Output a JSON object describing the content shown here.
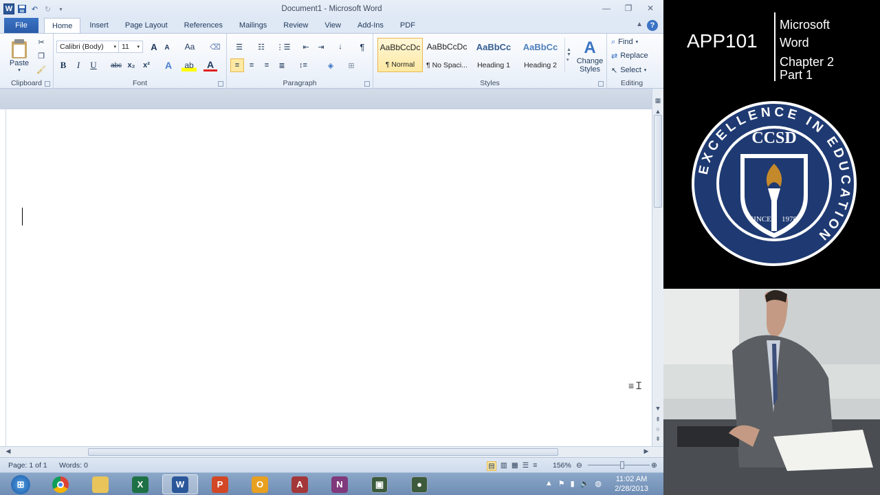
{
  "window": {
    "title": "Document1 - Microsoft Word",
    "logo": "W"
  },
  "qat": {
    "icons": [
      "word-app-icon",
      "save-icon",
      "undo-icon",
      "redo-icon",
      "customize-qat-icon"
    ]
  },
  "tabs": [
    "File",
    "Home",
    "Insert",
    "Page Layout",
    "References",
    "Mailings",
    "Review",
    "View",
    "Add-Ins",
    "PDF"
  ],
  "active_tab": "Home",
  "ribbon": {
    "clipboard": {
      "label": "Clipboard",
      "paste": "Paste"
    },
    "font": {
      "label": "Font",
      "family": "Calibri (Body)",
      "size": "11",
      "grow": "A",
      "shrink": "A",
      "case": "Aa",
      "bold": "B",
      "italic": "I",
      "underline": "U",
      "strike": "abc",
      "sub": "x₂",
      "sup": "x²"
    },
    "paragraph": {
      "label": "Paragraph"
    },
    "styles": {
      "label": "Styles",
      "items": [
        {
          "preview": "AaBbCcDc",
          "name": "¶ Normal",
          "selected": true
        },
        {
          "preview": "AaBbCcDc",
          "name": "¶ No Spaci...",
          "selected": false
        },
        {
          "preview": "AaBbCc",
          "name": "Heading 1",
          "selected": false
        },
        {
          "preview": "AaBbCc",
          "name": "Heading 2",
          "selected": false
        }
      ],
      "change": "Change Styles"
    },
    "editing": {
      "label": "Editing",
      "find": "Find",
      "replace": "Replace",
      "select": "Select"
    }
  },
  "status": {
    "page": "Page: 1 of 1",
    "words": "Words: 0",
    "zoom": "156%"
  },
  "taskbar": {
    "apps": [
      "start-orb",
      "chrome",
      "explorer",
      "excel",
      "word",
      "powerpoint",
      "outlook",
      "access",
      "onenote",
      "camtasia",
      "camtasia-recorder"
    ],
    "active": "word",
    "time": "11:02 AM",
    "date": "2/28/2013"
  },
  "overlay": {
    "course": "APP101",
    "line1": "Microsoft",
    "line2": "Word",
    "line3": "Chapter 2",
    "line4": "Part 1"
  },
  "seal": {
    "center": "CCSD",
    "ring": "EXCELLENCE IN EDUCATION",
    "since": "SINCE 1978",
    "navy": "#1f3a72",
    "gold": "#c4892b"
  }
}
